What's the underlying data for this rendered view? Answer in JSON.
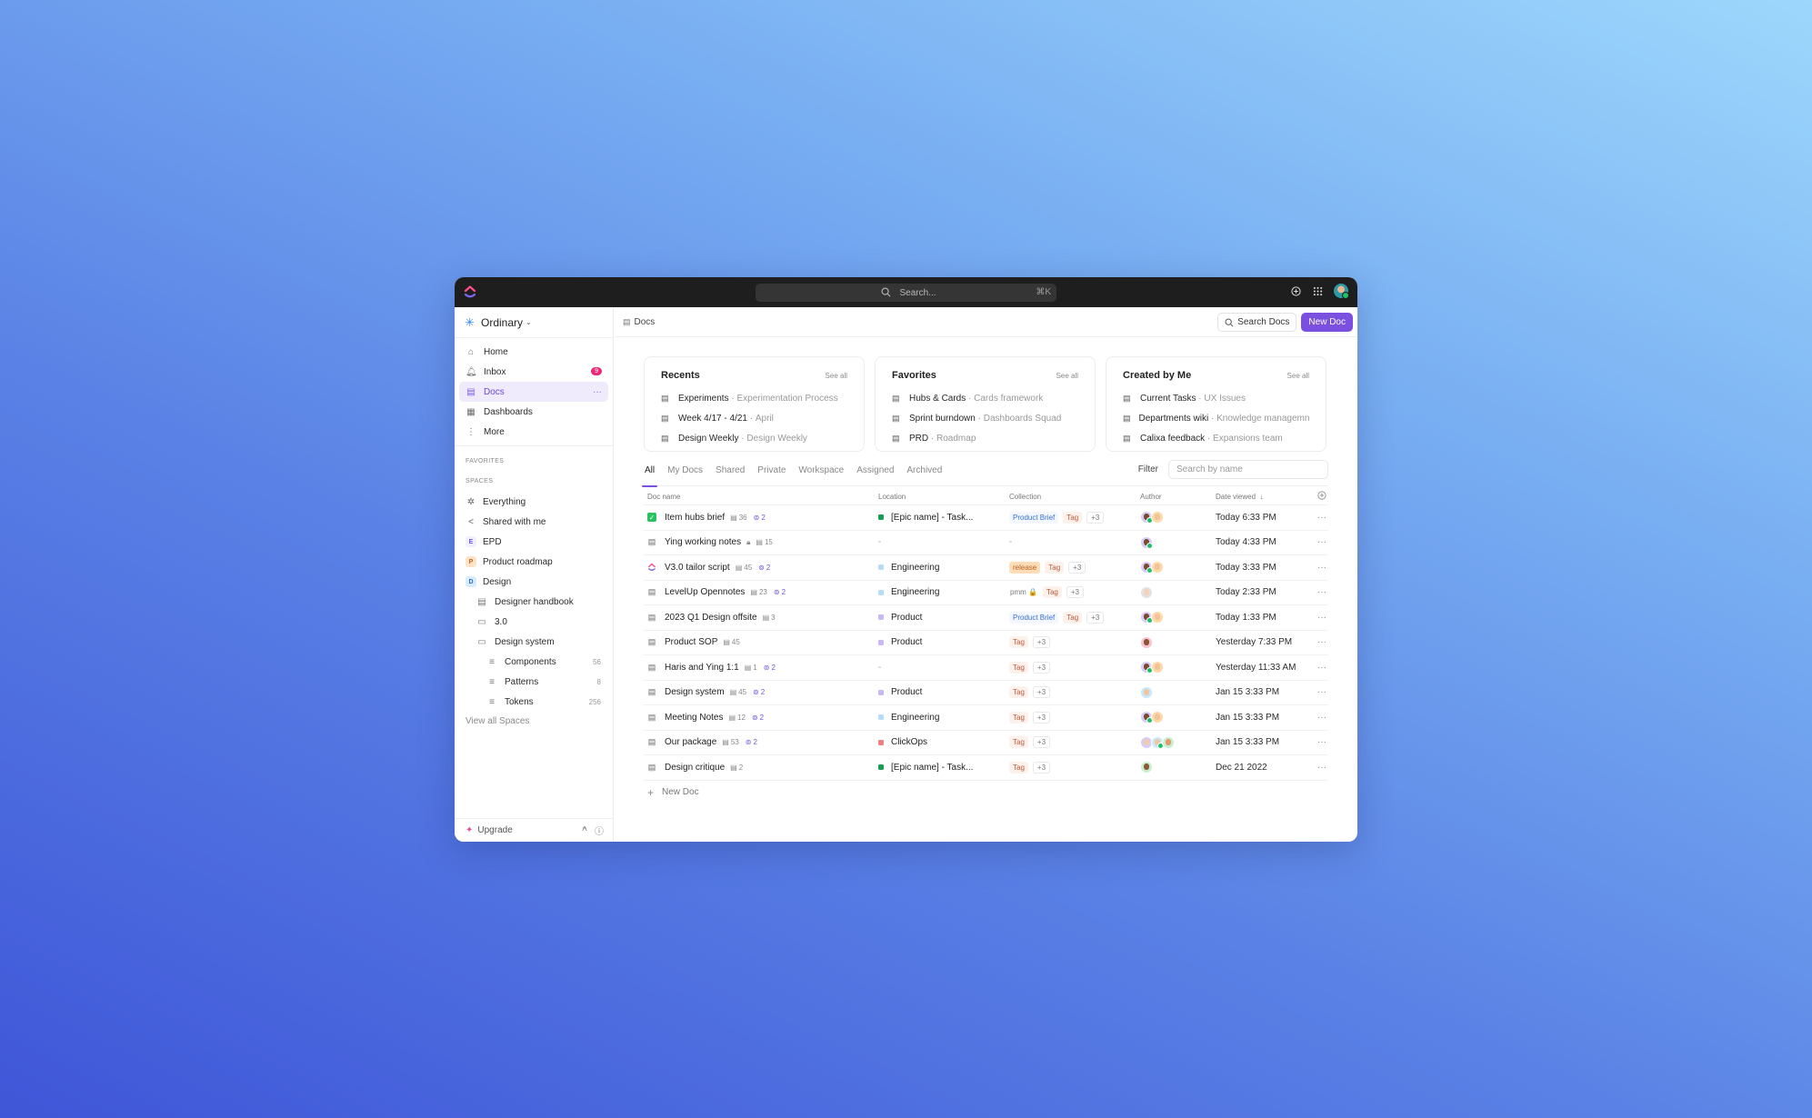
{
  "topbar": {
    "search_placeholder": "Search...",
    "search_shortcut": "⌘K"
  },
  "sidebar": {
    "workspace_name": "Ordinary",
    "nav": [
      {
        "label": "Home",
        "icon": "home-icon"
      },
      {
        "label": "Inbox",
        "icon": "bell-icon",
        "badge": "9"
      },
      {
        "label": "Docs",
        "icon": "docs-icon",
        "active": true
      },
      {
        "label": "Dashboards",
        "icon": "dashboard-icon"
      },
      {
        "label": "More",
        "icon": "more-vertical-icon"
      }
    ],
    "favorites_label": "FAVORITES",
    "spaces_label": "SPACES",
    "spaces": [
      {
        "label": "Everything",
        "icon": "everything-icon"
      },
      {
        "label": "Shared with me",
        "icon": "share-icon"
      },
      {
        "label": "EPD",
        "letter": "E"
      },
      {
        "label": "Product roadmap",
        "letter": "P"
      },
      {
        "label": "Design",
        "letter": "D"
      }
    ],
    "design_children": [
      {
        "label": "Designer handbook",
        "icon": "doc-icon"
      },
      {
        "label": "3.0",
        "icon": "folder-icon"
      },
      {
        "label": "Design system",
        "icon": "folder-open-icon"
      }
    ],
    "design_system_children": [
      {
        "label": "Components",
        "count": "56"
      },
      {
        "label": "Patterns",
        "count": "8"
      },
      {
        "label": "Tokens",
        "count": "256"
      }
    ],
    "view_all_spaces": "View all Spaces",
    "upgrade_label": "Upgrade"
  },
  "header": {
    "breadcrumb": "Docs",
    "search_docs_label": "Search Docs",
    "new_doc_label": "New Doc"
  },
  "cards": [
    {
      "title": "Recents",
      "see_all": "See all",
      "items": [
        {
          "name": "Experiments",
          "sub": "Experimentation Process"
        },
        {
          "name": "Week 4/17 - 4/21",
          "sub": "April"
        },
        {
          "name": "Design Weekly",
          "sub": "Design Weekly"
        }
      ]
    },
    {
      "title": "Favorites",
      "see_all": "See all",
      "items": [
        {
          "name": "Hubs & Cards",
          "sub": "Cards framework"
        },
        {
          "name": "Sprint burndown",
          "sub": "Dashboards Squad"
        },
        {
          "name": "PRD",
          "sub": "Roadmap"
        }
      ]
    },
    {
      "title": "Created by Me",
      "see_all": "See all",
      "items": [
        {
          "name": "Current Tasks",
          "sub": "UX Issues"
        },
        {
          "name": "Departments wiki",
          "sub": "Knowledge managemnt"
        },
        {
          "name": "Calixa feedback",
          "sub": "Expansions team"
        }
      ]
    }
  ],
  "tabs": [
    "All",
    "My Docs",
    "Shared",
    "Private",
    "Workspace",
    "Assigned",
    "Archived"
  ],
  "active_tab": "All",
  "filter": {
    "label": "Filter",
    "placeholder": "Search by name"
  },
  "table": {
    "columns": [
      "Doc name",
      "Location",
      "Collection",
      "Author",
      "Date viewed"
    ],
    "rows": [
      {
        "name": "Item hubs brief",
        "icon": "check",
        "pages": "36",
        "shared": "2",
        "location": "[Epic name] - Task...",
        "loc_color": "#1a9c54",
        "collection": [
          {
            "t": "Product Brief",
            "k": "brief"
          },
          {
            "t": "Tag",
            "k": "tag"
          },
          {
            "t": "+3",
            "k": "more"
          }
        ],
        "authors": [
          "a",
          "b"
        ],
        "date": "Today 6:33 PM"
      },
      {
        "name": "Ying working notes",
        "icon": "doc",
        "locked": true,
        "pages": "15",
        "shared": null,
        "location": null,
        "collection": null,
        "authors": [
          "a"
        ],
        "date": "Today 4:33 PM"
      },
      {
        "name": "V3.0 tailor script",
        "icon": "brand",
        "pages": "45",
        "shared": "2",
        "location": "Engineering",
        "loc_color": "#b5dcf9",
        "collection": [
          {
            "t": "release",
            "k": "release"
          },
          {
            "t": "Tag",
            "k": "tag"
          },
          {
            "t": "+3",
            "k": "more"
          }
        ],
        "authors": [
          "a",
          "b"
        ],
        "date": "Today 3:33 PM"
      },
      {
        "name": "LevelUp Opennotes",
        "icon": "doc",
        "pages": "23",
        "shared": "2",
        "location": "Engineering",
        "loc_color": "#b5dcf9",
        "collection": [
          {
            "t": "pmm 🔒",
            "k": "pmm"
          },
          {
            "t": "Tag",
            "k": "tag"
          },
          {
            "t": "+3",
            "k": "more"
          }
        ],
        "authors": [
          "c"
        ],
        "date": "Today 2:33 PM"
      },
      {
        "name": "2023 Q1 Design offsite",
        "icon": "doc",
        "pages": "3",
        "shared": null,
        "location": "Product",
        "loc_color": "#c8b8f5",
        "collection": [
          {
            "t": "Product Brief",
            "k": "brief"
          },
          {
            "t": "Tag",
            "k": "tag"
          },
          {
            "t": "+3",
            "k": "more"
          }
        ],
        "authors": [
          "a",
          "b"
        ],
        "date": "Today 1:33 PM"
      },
      {
        "name": "Product SOP",
        "icon": "doc",
        "pages": "45",
        "shared": null,
        "location": "Product",
        "loc_color": "#c8b8f5",
        "collection": [
          {
            "t": "Tag",
            "k": "tag"
          },
          {
            "t": "+3",
            "k": "more"
          }
        ],
        "authors": [
          "d"
        ],
        "date": "Yesterday 7:33 PM"
      },
      {
        "name": "Haris and Ying 1:1",
        "icon": "doc",
        "pages": "1",
        "shared": "2",
        "location": null,
        "collection": [
          {
            "t": "Tag",
            "k": "tag"
          },
          {
            "t": "+3",
            "k": "more"
          }
        ],
        "authors": [
          "a",
          "b"
        ],
        "date": "Yesterday 11:33 AM"
      },
      {
        "name": "Design system",
        "icon": "doc",
        "pages": "45",
        "shared": "2",
        "location": "Product",
        "loc_color": "#c8b8f5",
        "collection": [
          {
            "t": "Tag",
            "k": "tag"
          },
          {
            "t": "+3",
            "k": "more"
          }
        ],
        "authors": [
          "e"
        ],
        "date": "Jan 15 3:33 PM"
      },
      {
        "name": "Meeting Notes",
        "icon": "doc",
        "pages": "12",
        "shared": "2",
        "location": "Engineering",
        "loc_color": "#b5dcf9",
        "collection": [
          {
            "t": "Tag",
            "k": "tag"
          },
          {
            "t": "+3",
            "k": "more"
          }
        ],
        "authors": [
          "a",
          "b"
        ],
        "date": "Jan 15 3:33 PM"
      },
      {
        "name": "Our package",
        "icon": "doc",
        "pages": "53",
        "shared": "2",
        "location": "ClickOps",
        "loc_color": "#f08080",
        "collection": [
          {
            "t": "Tag",
            "k": "tag"
          },
          {
            "t": "+3",
            "k": "more"
          }
        ],
        "authors": [
          "f",
          "e2",
          "g"
        ],
        "date": "Jan 15 3:33 PM"
      },
      {
        "name": "Design critique",
        "icon": "doc",
        "pages": "2",
        "shared": null,
        "location": "[Epic name] - Task...",
        "loc_color": "#1a9c54",
        "collection": [
          {
            "t": "Tag",
            "k": "tag"
          },
          {
            "t": "+3",
            "k": "more"
          }
        ],
        "authors": [
          "h"
        ],
        "date": "Dec 21 2022"
      }
    ],
    "new_doc_label": "New Doc"
  },
  "colors": {
    "accent": "#7b4fe0",
    "inbox_badge": "#ea2a79"
  }
}
